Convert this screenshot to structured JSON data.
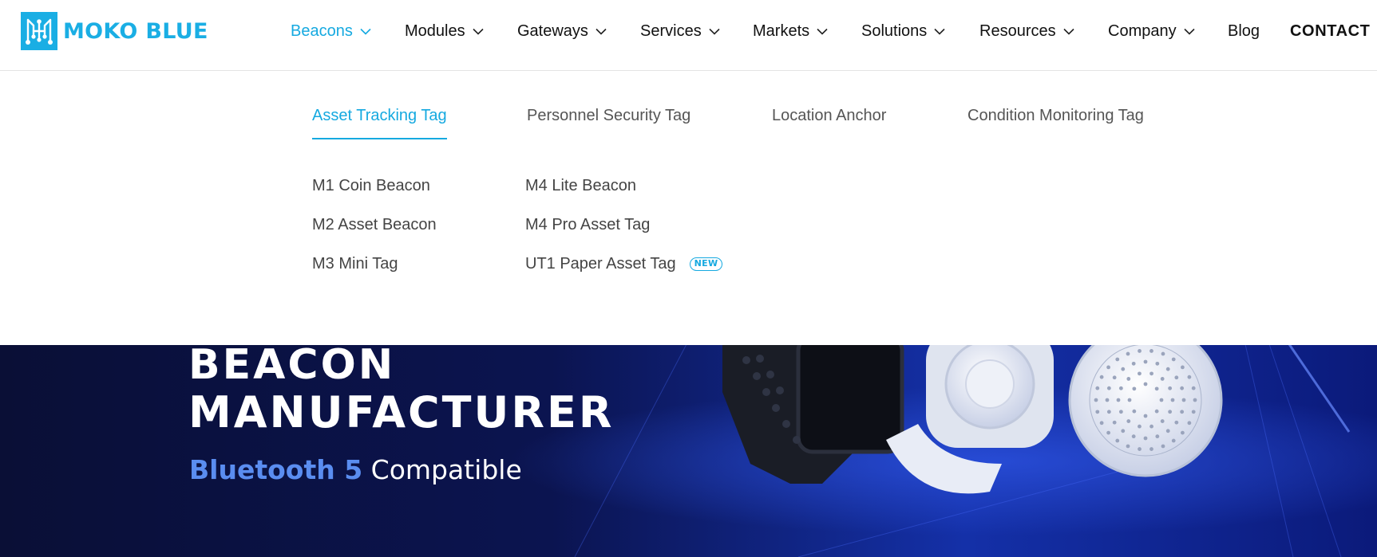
{
  "brand": {
    "name": "MOKO BLUE",
    "icon": "circuit-logo-icon",
    "color": "#1aaee4"
  },
  "nav": {
    "items": [
      {
        "label": "Beacons",
        "active": true
      },
      {
        "label": "Modules"
      },
      {
        "label": "Gateways"
      },
      {
        "label": "Services"
      },
      {
        "label": "Markets"
      },
      {
        "label": "Solutions"
      },
      {
        "label": "Resources"
      },
      {
        "label": "Company"
      },
      {
        "label": "Blog"
      }
    ],
    "contact": "CONTACT",
    "active_color": "#15a9e0"
  },
  "mega_menu": {
    "categories": [
      {
        "label": "Asset Tracking Tag",
        "active": true
      },
      {
        "label": "Personnel Security Tag"
      },
      {
        "label": "Location Anchor"
      },
      {
        "label": "Condition Monitoring Tag"
      }
    ],
    "products_col1": [
      "M1 Coin Beacon",
      "M2 Asset Beacon",
      "M3 Mini Tag"
    ],
    "products_col2": [
      {
        "label": "M4 Lite Beacon"
      },
      {
        "label": "M4 Pro Asset Tag"
      },
      {
        "label": "UT1 Paper Asset Tag",
        "badge": "NEW"
      }
    ]
  },
  "hero": {
    "line1": "BEACON",
    "line2": "MANUFACTURER",
    "subtitle_highlight": "Bluetooth 5",
    "subtitle_rest": " Compatible",
    "background_color": "#0b1450",
    "highlight_color": "#5a8df0"
  }
}
